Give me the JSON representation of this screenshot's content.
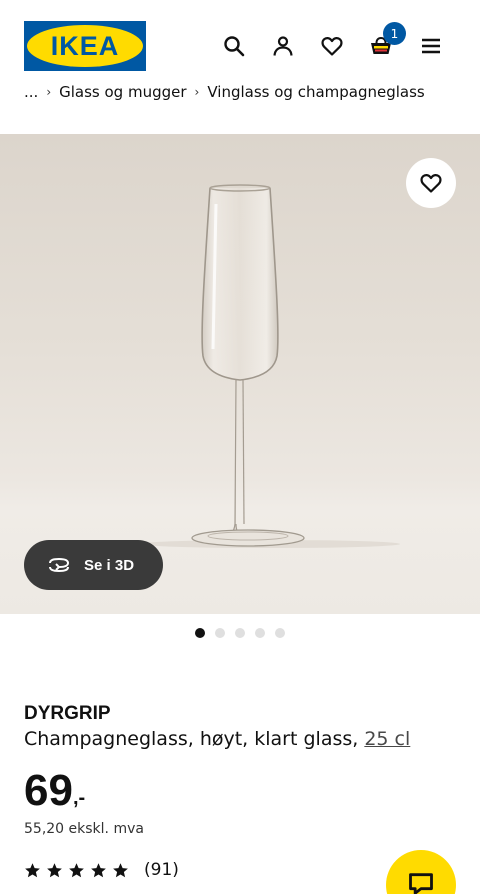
{
  "header": {
    "logo_text": "IKEA",
    "icons": [
      "search-icon",
      "account-icon",
      "favourites-icon",
      "cart-icon",
      "menu-icon"
    ],
    "cart_count": "1"
  },
  "breadcrumb": {
    "ellipsis": "...",
    "items": [
      "Glass og mugger",
      "Vinglass og champagneglass"
    ]
  },
  "gallery": {
    "button_3d": "Se i 3D",
    "image_count": 5,
    "active_index": 0
  },
  "product": {
    "name": "DYRGRIP",
    "description": "Champagneglass, høyt, klart glass, ",
    "size": "25 cl",
    "price_main": "69",
    "price_suffix": ",-",
    "price_ex_vat": "55,20 ekskl. mva",
    "rating_stars": 5,
    "rating_count": "(91)"
  },
  "colors": {
    "brand_blue": "#0058a3",
    "brand_yellow": "#ffdb00"
  }
}
